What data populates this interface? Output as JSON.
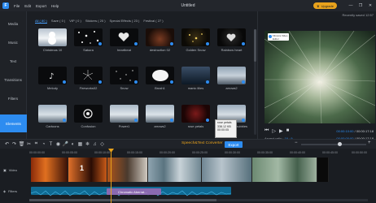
{
  "titlebar": {
    "logo": "F",
    "menu": [
      "File",
      "Edit",
      "Export",
      "Help"
    ],
    "title": "Untitled",
    "upgrade": "Upgrade",
    "buttons": [
      "—",
      "❐",
      "✕"
    ]
  },
  "sidebar": {
    "items": [
      "Media",
      "Music",
      "Text",
      "Transitions",
      "Filters",
      "Overlays",
      "Elements"
    ],
    "active": "Elements"
  },
  "library": {
    "tabs": [
      "All ( 80 )",
      "Save ( 0 )",
      "VIP ( 0 )",
      "Stickers ( 20 )",
      "Special Effects ( 23 )",
      "Festival ( 27 )"
    ],
    "items": [
      "Christmas 10",
      "Sakura",
      "heartbeat",
      "destruction 02",
      "Golden Snow",
      "Rainbow heart",
      "Melody",
      "Fireworks02",
      "Snow",
      "Brush1",
      "manic lilies",
      "arrows2",
      "Cartoons",
      "Confusion",
      "Power1",
      "arrows2",
      "rose petals",
      "Heart shaped bubbles"
    ],
    "tooltip": [
      "rose petals",
      "338.12 KB",
      "00:00:05"
    ]
  },
  "preview": {
    "saved": "Recently saved 12:57",
    "badge": "Filmora Video Editor",
    "controls": [
      "⏮",
      "▷",
      "▶",
      "■"
    ],
    "timecode_current": "00:00:10:00",
    "timecode_total": "00:00:17:18",
    "aspect_label": "Aspect ratio :",
    "aspect_value": "16 : 9",
    "tc2_current": "00:00:00:00",
    "tc2_total": "00:00:17:18"
  },
  "toolbar": {
    "speech": "Speech&Text Converter",
    "export": "Export"
  },
  "timeline": {
    "ruler": [
      "00:00:00:00",
      "00:00:05:00",
      "00:00:10:00",
      "00:00:15:00",
      "00:00:20:00",
      "00:00:25:00",
      "00:00:30:00",
      "00:00:35:00",
      "00:00:40:00",
      "00:00:45:00",
      "00:00:50:00"
    ],
    "video_label": "Video",
    "filter_label": "Filters",
    "filter_name": "Chromatic Aberrat..."
  },
  "colors": {
    "accent": "#2d8cf0",
    "upgrade": "#e8a21c",
    "audio": "#0f6a93",
    "filter": "#8a6ab0"
  }
}
